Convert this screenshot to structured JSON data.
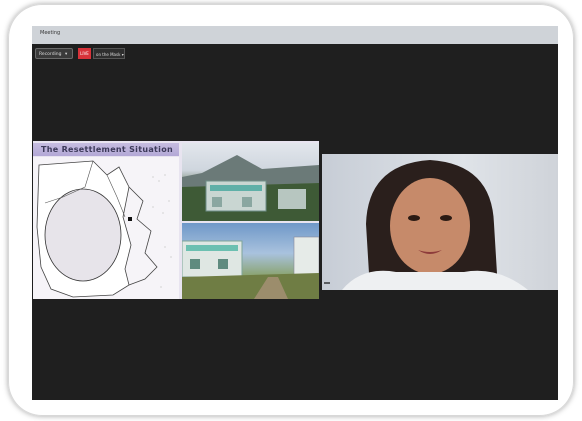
{
  "window": {
    "title": "Meeting"
  },
  "toolbar": {
    "recording_label": "Recording",
    "live_label": "LIVE",
    "view_label": "on the Mask"
  },
  "slide": {
    "title": "The Resettlement Situation"
  },
  "camera": {
    "name_label": ""
  }
}
